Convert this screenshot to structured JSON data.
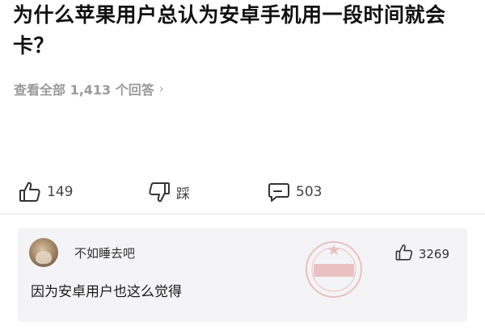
{
  "question": {
    "title": "为什么苹果用户总认为安卓手机用一段时间就会卡？",
    "view_all_label": "查看全部 1,413 个回答",
    "view_all_chevron": "›"
  },
  "actions": {
    "like_count": "149",
    "dislike_label": "踩",
    "comment_count": "503"
  },
  "comment": {
    "username": "不如睡去吧",
    "like_count": "3269",
    "text": "因为安卓用户也这么觉得"
  },
  "colors": {
    "muted_text": "#9a9a9a",
    "card_background": "#f4f4f6",
    "icon_stroke": "#333333",
    "watermark": "#d23c3c"
  }
}
